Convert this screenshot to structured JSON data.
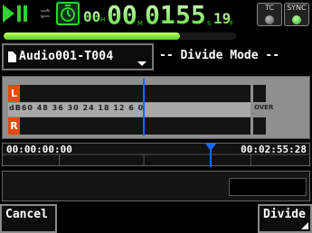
{
  "status_bar": {
    "icons": [
      "play-pause-icon",
      "loop-icon",
      "timer-icon"
    ],
    "time_counter": "00H00M01S55F19",
    "tc_label": "TC",
    "sync_label": "SYNC",
    "colors": {
      "accent_green": "#2fd42f",
      "ch_tag_orange": "#e64a10",
      "marker_blue": "#1668ff"
    },
    "progress": 0.76
  },
  "file": {
    "name": "Audio001-T004",
    "mode": "-- Divide Mode --"
  },
  "meter": {
    "left_label": "L",
    "right_label": "R",
    "scale_text": "dB60  48  36  30  24  18  12  6  0",
    "over_label": "OVER"
  },
  "timeline": {
    "start_time": "00:00:00:00",
    "end_time": "00:02:55:28"
  },
  "buttons": {
    "cancel": "Cancel",
    "divide": "Divide"
  }
}
